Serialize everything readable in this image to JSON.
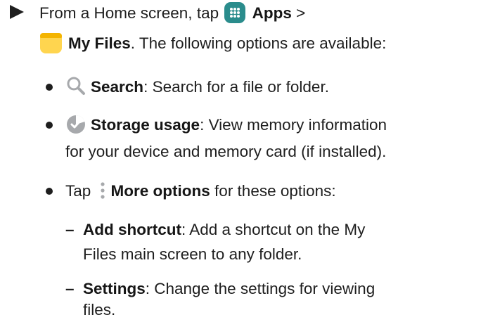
{
  "intro": {
    "line1_prefix": "From a Home screen, tap",
    "apps_label": "Apps",
    "apps_suffix": ">",
    "myfiles_label": "My Files",
    "line2_suffix": ". The following options are available:",
    "apps_icon": "apps-grid-icon",
    "myfiles_icon": "folder-icon"
  },
  "bullets": [
    {
      "icon": "search-icon",
      "term": "Search",
      "desc": ": Search for a file or folder."
    },
    {
      "icon": "storage-pie-icon",
      "term": "Storage usage",
      "desc_line1": ": View memory information",
      "desc_line2": "for your device and memory card (if installed)."
    },
    {
      "icon": "more-options-icon",
      "prefix": "Tap",
      "term": "More options",
      "desc": " for these options:"
    }
  ],
  "subitems": [
    {
      "dash": "–",
      "term": "Add shortcut",
      "desc_line1": ": Add a shortcut on the My",
      "desc_line2": "Files main screen to any folder."
    },
    {
      "dash": "–",
      "term": "Settings",
      "desc_line1": ": Change the settings for viewing",
      "desc_line2": "files."
    }
  ],
  "colors": {
    "apps_icon_bg": "#2a8c8c",
    "folder_yellow": "#ffd54f",
    "folder_orange": "#f4b400",
    "icon_gray": "#a7a9ac"
  }
}
